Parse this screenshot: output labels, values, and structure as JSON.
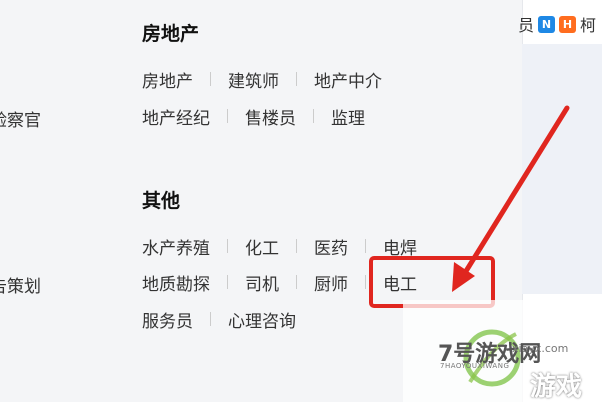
{
  "left_partial": {
    "line1": "验察官",
    "line2": "告策划"
  },
  "categories": [
    {
      "title": "房地产",
      "rows": [
        [
          "房地产",
          "建筑师",
          "地产中介"
        ],
        [
          "地产经纪",
          "售楼员",
          "监理"
        ]
      ]
    },
    {
      "title": "其他",
      "rows": [
        [
          "水产养殖",
          "化工",
          "医药",
          "电焊"
        ],
        [
          "地质勘探",
          "司机",
          "厨师",
          "电工"
        ],
        [
          "服务员",
          "心理咨询"
        ]
      ]
    }
  ],
  "top_right": {
    "text_left": "员",
    "badge_n": "N",
    "badge_h": "H",
    "text_right": "柯"
  },
  "watermark": {
    "brand": "7号游戏网",
    "domain": "xiayx.com",
    "pinyin": "7HAOYOUXIWANG",
    "subtitle": "游戏"
  },
  "colors": {
    "annotation": "#e0261f",
    "badge_n": "#1e88e5",
    "badge_h": "#ff6d1f"
  }
}
